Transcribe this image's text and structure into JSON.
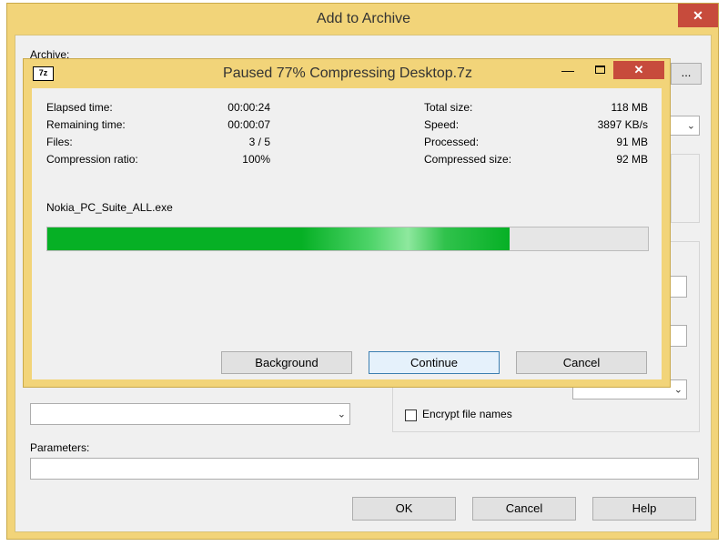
{
  "archive_window": {
    "title": "Add to Archive",
    "close_glyph": "✕",
    "archive_label": "Archive:",
    "browse_label": "...",
    "encrypt_file_names_label": "Encrypt file names",
    "encrypt_file_names_checked": false,
    "parameters_label": "Parameters:",
    "parameters_value": "",
    "ok_label": "OK",
    "cancel_label": "Cancel",
    "help_label": "Help"
  },
  "progress_dialog": {
    "app_icon_text": "7z",
    "title": "Paused 77% Compressing Desktop.7z",
    "minimize_glyph": "—",
    "close_glyph": "✕",
    "stats_left": [
      {
        "label": "Elapsed time:",
        "value": "00:00:24"
      },
      {
        "label": "Remaining time:",
        "value": "00:00:07"
      },
      {
        "label": "Files:",
        "value": "3 / 5"
      },
      {
        "label": "Compression ratio:",
        "value": "100%"
      }
    ],
    "stats_right": [
      {
        "label": "Total size:",
        "value": "118 MB"
      },
      {
        "label": "Speed:",
        "value": "3897 KB/s"
      },
      {
        "label": "Processed:",
        "value": "91 MB"
      },
      {
        "label": "Compressed size:",
        "value": "92 MB"
      }
    ],
    "current_file": "Nokia_PC_Suite_ALL.exe",
    "progress_percent": 77,
    "background_label": "Background",
    "continue_label": "Continue",
    "cancel_label": "Cancel"
  },
  "colors": {
    "frame": "#f2d479",
    "close_button": "#c74b3c",
    "progress_fill": "#06b025"
  }
}
